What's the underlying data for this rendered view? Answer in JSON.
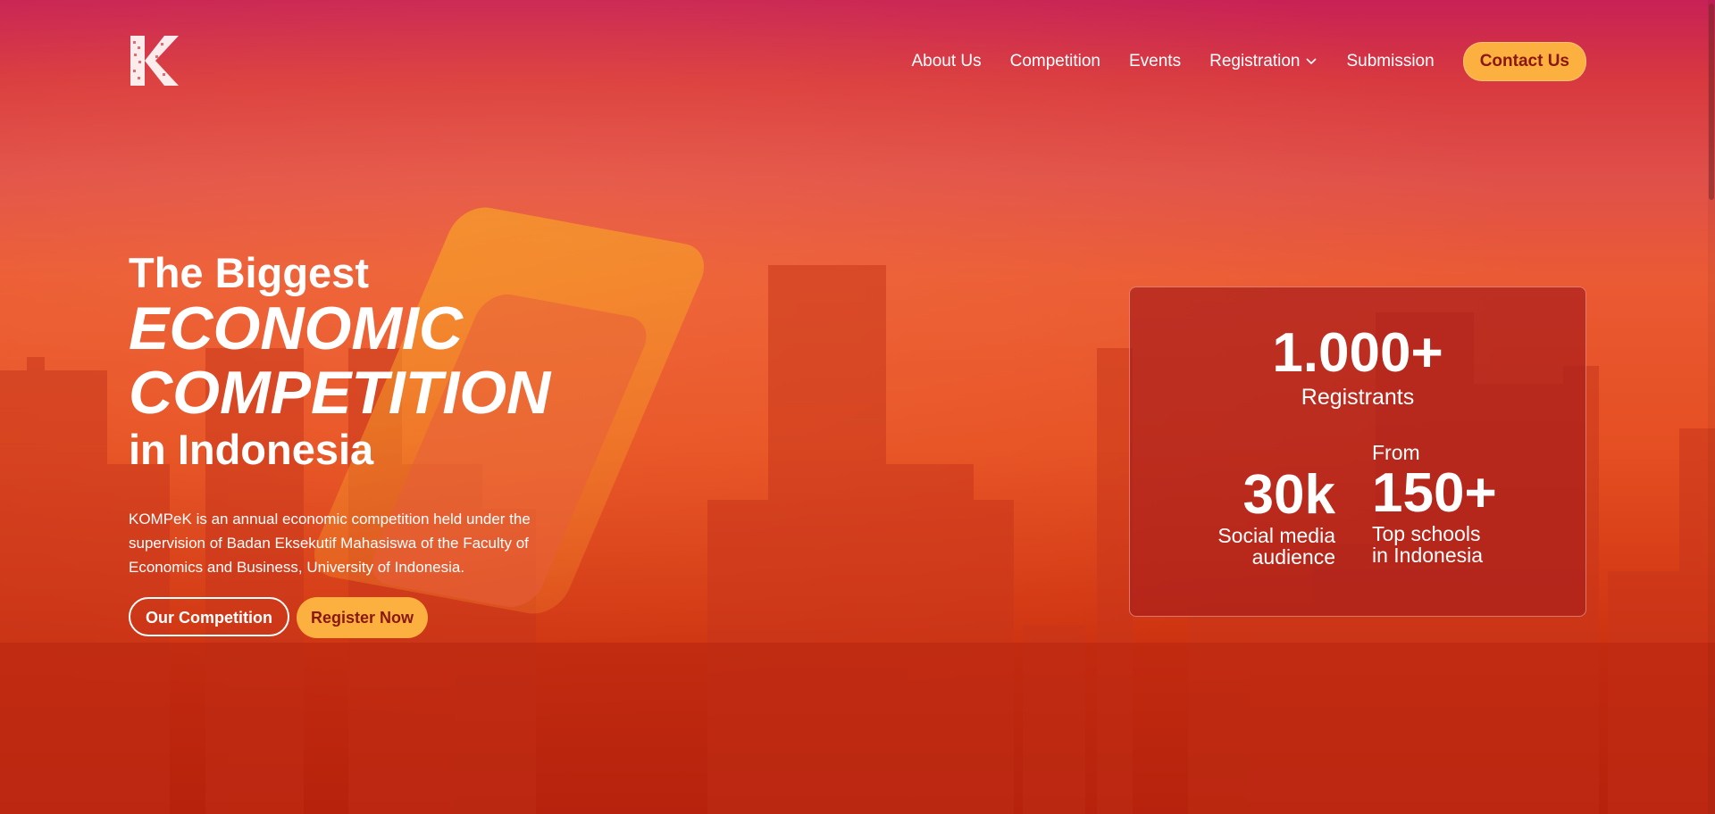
{
  "brand": {
    "logo_icon": "kompek-letter-k-logo-icon",
    "accent_color": "#fbb040",
    "dark_red": "#8a1712"
  },
  "nav": {
    "items": [
      {
        "label": "About Us"
      },
      {
        "label": "Competition"
      },
      {
        "label": "Events"
      },
      {
        "label": "Registration",
        "icon": "chevron-down-icon"
      },
      {
        "label": "Submission"
      }
    ],
    "contact_label": "Contact Us"
  },
  "hero": {
    "line1": "The Biggest",
    "line2": "ECONOMIC",
    "line3": "COMPETITION",
    "line4": "in Indonesia",
    "description": "KOMPeK is an annual economic competition held under the supervision of Badan Eksekutif Mahasiswa of the Faculty of Economics and Business, University of Indonesia.",
    "primary_button": "Our Competition",
    "secondary_button": "Register Now"
  },
  "stats": {
    "registrants_value": "1.000+",
    "registrants_label": "Registrants",
    "audience_value": "30k",
    "audience_label_1": "Social media",
    "audience_label_2": "audience",
    "schools_prefix": "From",
    "schools_value": "150+",
    "schools_label_1": "Top schools",
    "schools_label_2": "in Indonesia"
  }
}
